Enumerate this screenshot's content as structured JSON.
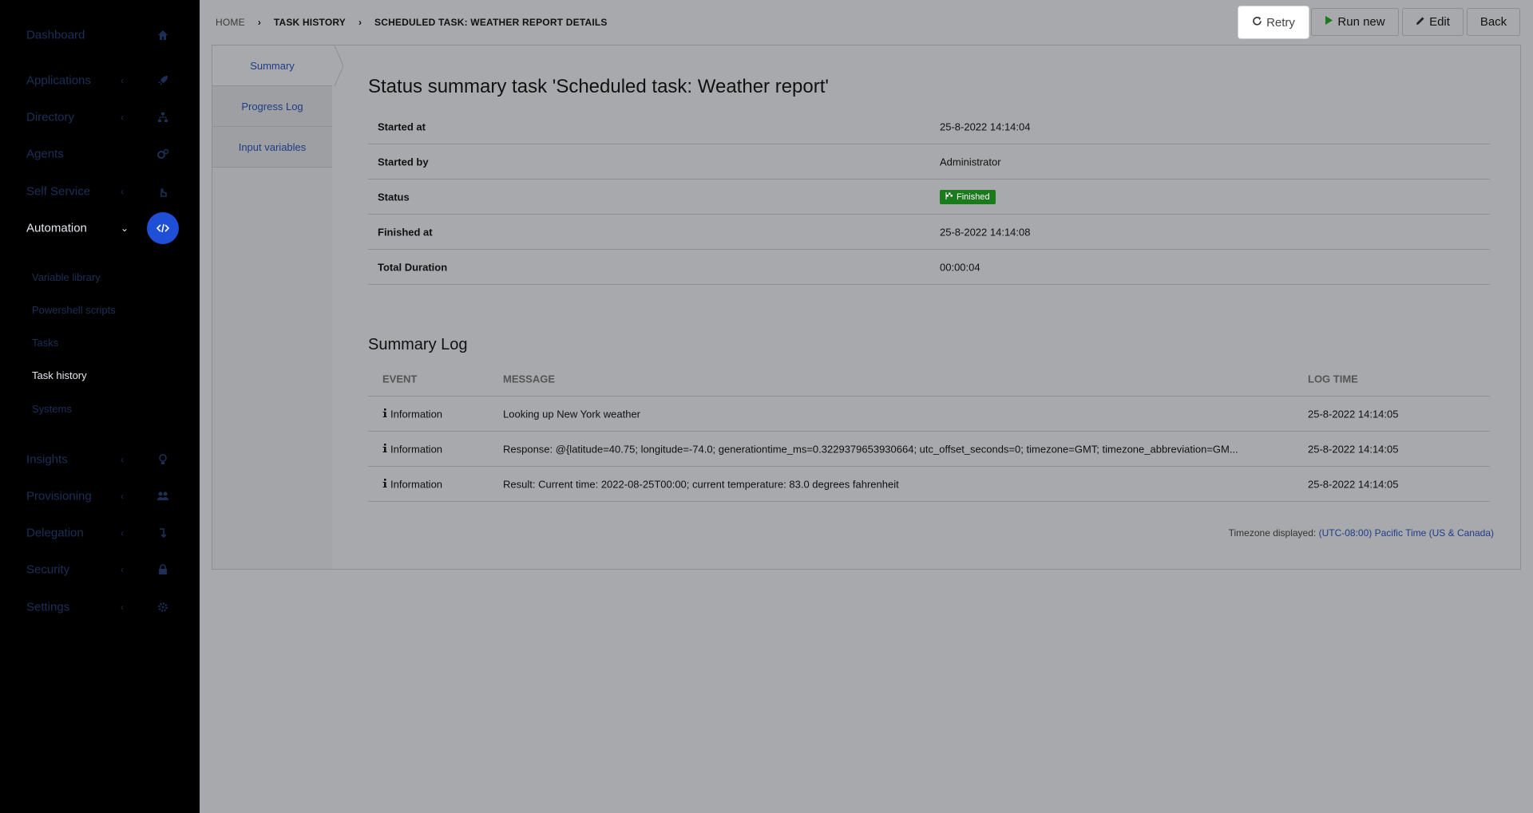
{
  "sidebar": {
    "items": [
      {
        "label": "Dashboard",
        "icon": "home-icon",
        "chevron": false
      },
      {
        "label": "Applications",
        "icon": "rocket-icon",
        "chevron": true
      },
      {
        "label": "Directory",
        "icon": "sitemap-icon",
        "chevron": true
      },
      {
        "label": "Agents",
        "icon": "cogs-icon",
        "chevron": false
      },
      {
        "label": "Self Service",
        "icon": "hand-pointer-icon",
        "chevron": true
      },
      {
        "label": "Automation",
        "icon": "code-icon",
        "chevron": true,
        "active": true
      },
      {
        "label": "Insights",
        "icon": "lightbulb-icon",
        "chevron": true
      },
      {
        "label": "Provisioning",
        "icon": "users-icon",
        "chevron": true
      },
      {
        "label": "Delegation",
        "icon": "level-down-icon",
        "chevron": true
      },
      {
        "label": "Security",
        "icon": "lock-icon",
        "chevron": true
      },
      {
        "label": "Settings",
        "icon": "gear-icon",
        "chevron": true
      }
    ],
    "sub_items": [
      {
        "label": "Variable library"
      },
      {
        "label": "Powershell scripts"
      },
      {
        "label": "Tasks"
      },
      {
        "label": "Task history",
        "active": true
      },
      {
        "label": "Systems"
      }
    ]
  },
  "breadcrumb": {
    "home": "HOME",
    "task_history": "TASK HISTORY",
    "current": "SCHEDULED TASK: WEATHER REPORT DETAILS"
  },
  "toolbar": {
    "retry": "Retry",
    "run_new": "Run new",
    "edit": "Edit",
    "back": "Back"
  },
  "tabs": [
    "Summary",
    "Progress Log",
    "Input variables"
  ],
  "summary": {
    "title": "Status summary task 'Scheduled task: Weather report'",
    "rows": [
      {
        "label": "Started at",
        "value": "25-8-2022 14:14:04"
      },
      {
        "label": "Started by",
        "value": "Administrator"
      },
      {
        "label": "Status",
        "value": "Finished"
      },
      {
        "label": "Finished at",
        "value": "25-8-2022 14:14:08"
      },
      {
        "label": "Total Duration",
        "value": "00:00:04"
      }
    ]
  },
  "summary_log": {
    "title": "Summary Log",
    "headers": {
      "event": "EVENT",
      "message": "MESSAGE",
      "log_time": "LOG TIME"
    },
    "rows": [
      {
        "event": "Information",
        "message": "Looking up New York weather",
        "log_time": "25-8-2022 14:14:05"
      },
      {
        "event": "Information",
        "message": "Response: @{latitude=40.75; longitude=-74.0; generationtime_ms=0.3229379653930664; utc_offset_seconds=0; timezone=GMT; timezone_abbreviation=GM...",
        "log_time": "25-8-2022 14:14:05"
      },
      {
        "event": "Information",
        "message": "Result: Current time: 2022-08-25T00:00; current temperature: 83.0 degrees fahrenheit",
        "log_time": "25-8-2022 14:14:05"
      }
    ]
  },
  "timezone": {
    "label": "Timezone displayed:",
    "value": "(UTC-08:00) Pacific Time (US & Canada)"
  },
  "colors": {
    "accent": "#1e4fd6",
    "status_finished": "#1b7a1b",
    "link": "#1f3c88"
  }
}
